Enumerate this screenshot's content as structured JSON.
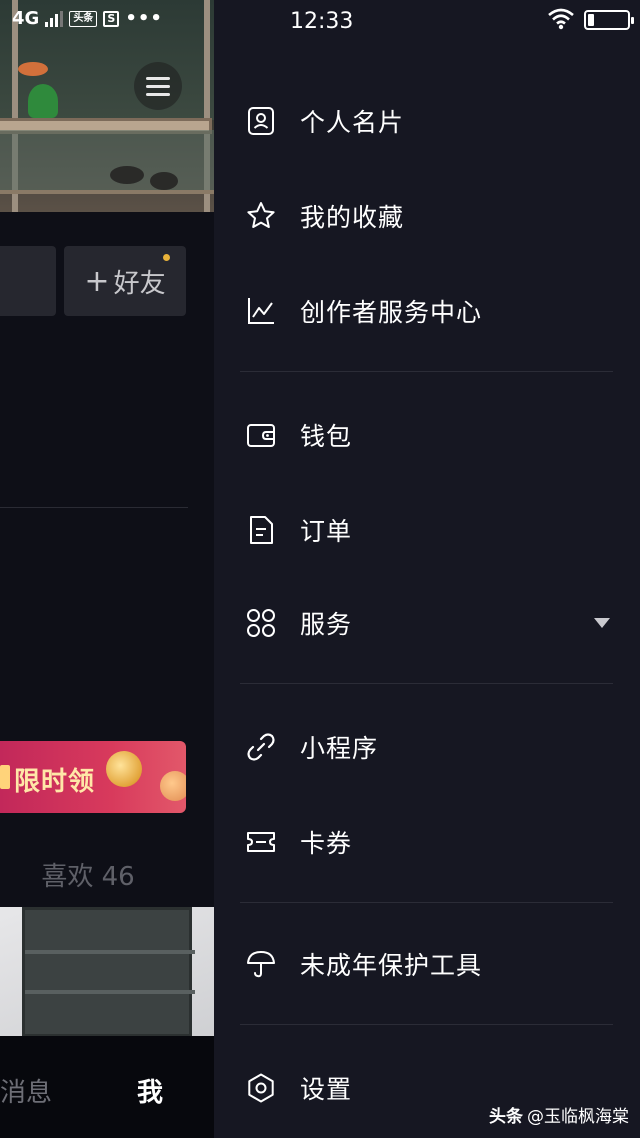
{
  "status_bar": {
    "network": "4G",
    "app_badge": "头条",
    "s_badge": "S",
    "more": "•••",
    "time": "12:33"
  },
  "profile": {
    "add_friend_label": "好友",
    "add_friend_plus": "+",
    "promo_text": "限时领",
    "likes_tab": "喜欢 46"
  },
  "bottom_nav": {
    "messages": "消息",
    "me": "我"
  },
  "drawer": {
    "items": [
      {
        "label": "个人名片",
        "icon": "id-card-icon"
      },
      {
        "label": "我的收藏",
        "icon": "star-icon"
      },
      {
        "label": "创作者服务中心",
        "icon": "line-chart-icon"
      },
      {
        "label": "钱包",
        "icon": "wallet-icon"
      },
      {
        "label": "订单",
        "icon": "document-icon"
      },
      {
        "label": "服务",
        "icon": "grid-icon"
      },
      {
        "label": "小程序",
        "icon": "link-icon"
      },
      {
        "label": "卡券",
        "icon": "ticket-icon"
      },
      {
        "label": "未成年保护工具",
        "icon": "umbrella-icon"
      },
      {
        "label": "设置",
        "icon": "gear-icon"
      }
    ]
  },
  "watermark": {
    "brand": "头条",
    "handle": "@玉临枫海棠"
  },
  "colors": {
    "drawer_bg": "#161722",
    "text": "#ffffff",
    "divider": "#2b2c37",
    "promo": "#c2285a"
  }
}
